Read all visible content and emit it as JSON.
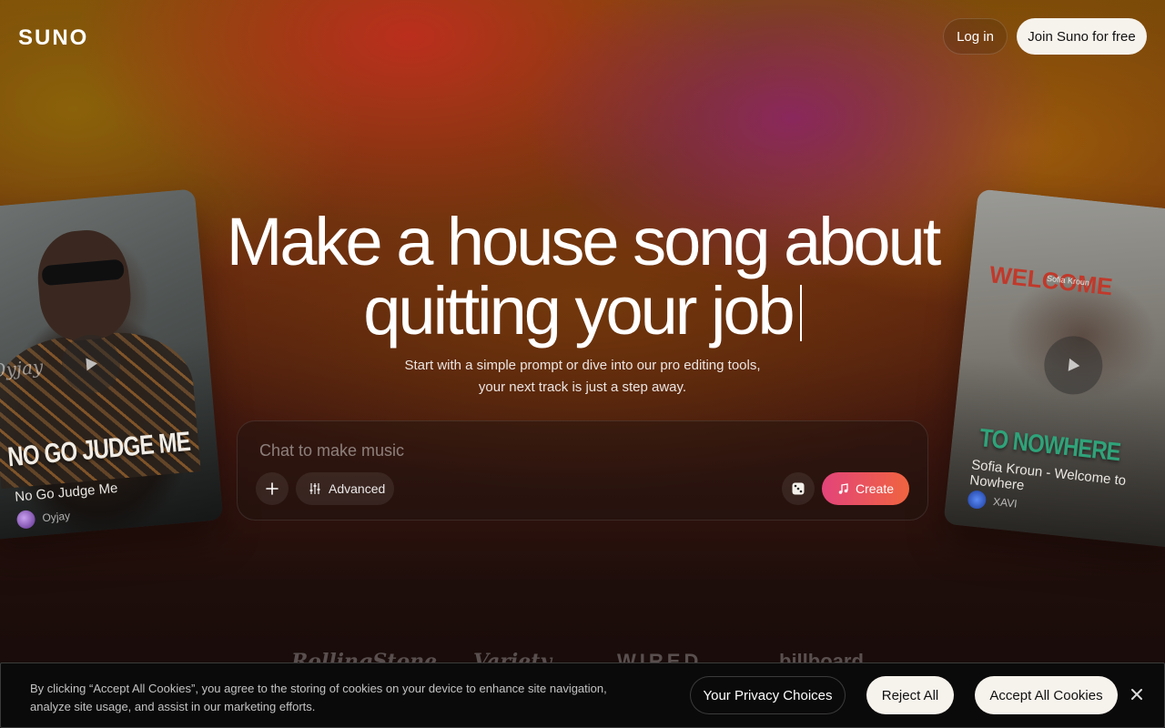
{
  "header": {
    "logo": "SUNO",
    "login_label": "Log in",
    "join_label": "Join Suno for free"
  },
  "hero": {
    "headline_line1": "Make a house song about",
    "headline_line2": "quitting your job",
    "subtext": "Start with a simple prompt or dive into our pro editing tools, your next track is just a step away."
  },
  "chat": {
    "placeholder": "Chat to make music",
    "advanced_label": "Advanced",
    "create_label": "Create",
    "icons": {
      "add": "plus-icon",
      "advanced": "sliders-icon",
      "random": "dice-icon",
      "create": "music-note-icon"
    }
  },
  "cards": {
    "left": {
      "cover_text": "NO GO JUDGE ME",
      "watermark": "Oyjay",
      "title": "No Go Judge Me",
      "artist": "Oyjay"
    },
    "right": {
      "cover_text": "TO NOWHERE",
      "cover_vertical": "WELCOME",
      "cover_badge": "Sofia Kroun",
      "title": "Sofia Kroun - Welcome to Nowhere",
      "artist": "XAVI"
    }
  },
  "press": [
    "RollingStone",
    "Variety",
    "WIRED",
    "billboard"
  ],
  "cookie": {
    "text": "By clicking “Accept All Cookies”, you agree to the storing of cookies on your device to enhance site navigation, analyze site usage, and assist in our marketing efforts.",
    "privacy_label": "Your Privacy Choices",
    "reject_label": "Reject All",
    "accept_label": "Accept All Cookies"
  },
  "colors": {
    "create_gradient_start": "#e3447a",
    "create_gradient_end": "#f0643f",
    "light_button": "#f6f2ec"
  }
}
